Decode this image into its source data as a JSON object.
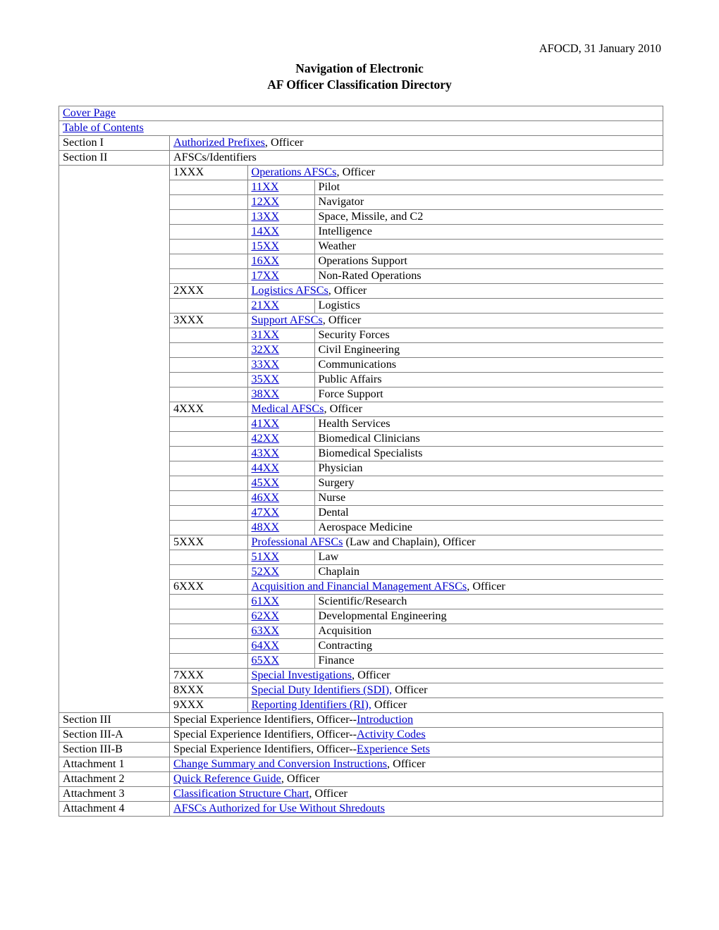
{
  "header": {
    "running_head": "AFOCD, 31 January 2010"
  },
  "title": {
    "line1": "Navigation of Electronic",
    "line2": "AF Officer Classification Directory"
  },
  "nav": {
    "cover_page": "Cover Page",
    "table_of_contents": "Table of Contents",
    "section_i": {
      "label": "Section I",
      "link": "Authorized Prefixes",
      "suffix": ", Officer"
    },
    "section_ii": {
      "label": "Section II",
      "text": "AFSCs/Identifiers"
    },
    "groups": [
      {
        "code": "1XXX",
        "link": "Operations AFSCs",
        "suffix": ", Officer",
        "children": [
          {
            "code": "11XX",
            "desc": "Pilot"
          },
          {
            "code": "12XX",
            "desc": "Navigator"
          },
          {
            "code": "13XX",
            "desc": "Space, Missile, and C2"
          },
          {
            "code": "14XX",
            "desc": "Intelligence"
          },
          {
            "code": "15XX",
            "desc": "Weather"
          },
          {
            "code": "16XX",
            "desc": "Operations Support"
          },
          {
            "code": "17XX",
            "desc": "Non-Rated Operations"
          }
        ]
      },
      {
        "code": "2XXX",
        "link": "Logistics AFSCs",
        "suffix": ", Officer",
        "children": [
          {
            "code": "21XX",
            "desc": "Logistics"
          }
        ]
      },
      {
        "code": "3XXX",
        "link": "Support AFSCs",
        "suffix": ", Officer",
        "children": [
          {
            "code": "31XX",
            "desc": "Security Forces"
          },
          {
            "code": "32XX",
            "desc": "Civil Engineering"
          },
          {
            "code": "33XX",
            "desc": "Communications"
          },
          {
            "code": "35XX",
            "desc": "Public Affairs"
          },
          {
            "code": "38XX",
            "desc": "Force Support"
          }
        ]
      },
      {
        "code": "4XXX",
        "link": "Medical AFSCs",
        "suffix": ", Officer",
        "children": [
          {
            "code": "41XX",
            "desc": "Health Services"
          },
          {
            "code": "42XX",
            "desc": "Biomedical Clinicians"
          },
          {
            "code": "43XX",
            "desc": "Biomedical Specialists"
          },
          {
            "code": "44XX",
            "desc": "Physician"
          },
          {
            "code": "45XX",
            "desc": "Surgery"
          },
          {
            "code": "46XX",
            "desc": "Nurse"
          },
          {
            "code": "47XX",
            "desc": "Dental"
          },
          {
            "code": "48XX",
            "desc": "Aerospace Medicine"
          }
        ]
      },
      {
        "code": "5XXX",
        "link": "Professional AFSCs",
        "suffix": " (Law and Chaplain), Officer",
        "children": [
          {
            "code": "51XX",
            "desc": "Law"
          },
          {
            "code": "52XX",
            "desc": "Chaplain"
          }
        ]
      },
      {
        "code": "6XXX",
        "link": "Acquisition and Financial Management AFSCs",
        "suffix": ", Officer",
        "children": [
          {
            "code": "61XX",
            "desc": "Scientific/Research"
          },
          {
            "code": "62XX",
            "desc": "Developmental Engineering"
          },
          {
            "code": "63XX",
            "desc": "Acquisition"
          },
          {
            "code": "64XX",
            "desc": "Contracting"
          },
          {
            "code": "65XX",
            "desc": "Finance"
          }
        ]
      },
      {
        "code": "7XXX",
        "link": "Special Investigations",
        "suffix": ", Officer",
        "children": []
      },
      {
        "code": "8XXX",
        "link": "Special Duty Identifiers (SDI),",
        "suffix": " Officer",
        "children": []
      },
      {
        "code": "9XXX",
        "link": "Reporting Identifiers (RI),",
        "suffix": " Officer",
        "children": []
      }
    ],
    "sections": [
      {
        "label": "Section III",
        "prefix": "Special Experience Identifiers, Officer--",
        "link": "Introduction"
      },
      {
        "label": "Section III-A",
        "prefix": "Special Experience Identifiers, Officer--",
        "link": "Activity Codes"
      },
      {
        "label": "Section III-B",
        "prefix": "Special Experience Identifiers, Officer--",
        "link": "Experience Sets"
      }
    ],
    "attachments": [
      {
        "label": "Attachment 1",
        "link": "Change Summary and Conversion Instructions",
        "suffix": ", Officer"
      },
      {
        "label": "Attachment 2",
        "link": "Quick Reference Guide",
        "suffix": ", Officer"
      },
      {
        "label": "Attachment 3",
        "link": "Classification Structure Chart",
        "suffix": ", Officer"
      },
      {
        "label": "Attachment 4",
        "link": "AFSCs Authorized for Use Without Shredouts",
        "suffix": ""
      }
    ]
  },
  "colors": {
    "link": "#0000CC",
    "border": "#808080",
    "text": "#000000"
  }
}
